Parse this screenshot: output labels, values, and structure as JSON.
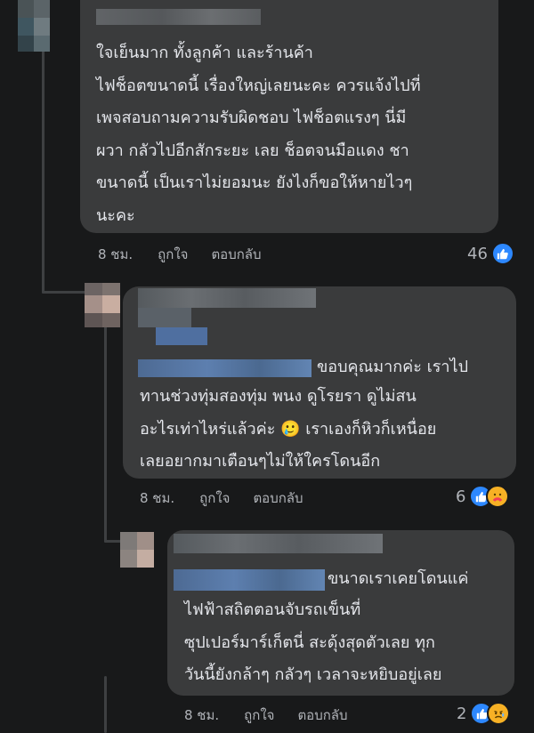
{
  "comments": [
    {
      "text": "ใจเย็นมาก ทั้งลูกค้า และร้านค้า\nไฟช็อตขนาดนี้ เรื่องใหญ่เลยนะคะ ควรแจ้งไปที่\nเพจสอบถามความรับผิดชอบ ไฟช็อตแรงๆ นี่มี\nผวา กลัวไปอีกสักระยะ เลย ช็อตจนมือแดง ชา\nขนาดนี้ เป็นเราไม่ยอมนะ  ยังไงก็ขอให้หายไวๆ\nนะคะ",
      "time": "8 ชม.",
      "like_label": "ถูกใจ",
      "reply_label": "ตอบกลับ",
      "reaction_count": "46",
      "reactions": [
        "like-icon"
      ]
    },
    {
      "first_line": "ขอบคุณมากค่ะ เราไป",
      "text": "ทานช่วงทุ่มสองทุ่ม พนง ดูโรยรา ดูไม่สน\nอะไรเท่าไหร่แล้วค่ะ 🥲 เราเองก็หิวก็เหนื่อย\nเลยอยากมาเตือนๆไม่ให้ใครโดนอีก",
      "time": "8 ชม.",
      "like_label": "ถูกใจ",
      "reply_label": "ตอบกลับ",
      "reaction_count": "6",
      "reactions": [
        "like-icon",
        "care-icon"
      ]
    },
    {
      "first_line": "ขนาดเราเคยโดนแค่",
      "text": "ไฟฟ้าสถิตตอนจับรถเข็นที่\nซุปเปอร์มาร์เก็ตนี่ สะดุ้งสุดตัวเลย ทุก\nวันนี้ยังกล้าๆ กลัวๆ เวลาจะหยิบอยู่เลย",
      "time": "8 ชม.",
      "like_label": "ถูกใจ",
      "reply_label": "ตอบกลับ",
      "reaction_count": "2",
      "reactions": [
        "like-icon",
        "sad-icon"
      ]
    }
  ],
  "colors": {
    "background": "#18191a",
    "bubble": "#3a3b3c",
    "text": "#e4e6eb",
    "meta": "#b0b3b8",
    "like": "#2d88ff",
    "emoji": "#f7b125"
  }
}
